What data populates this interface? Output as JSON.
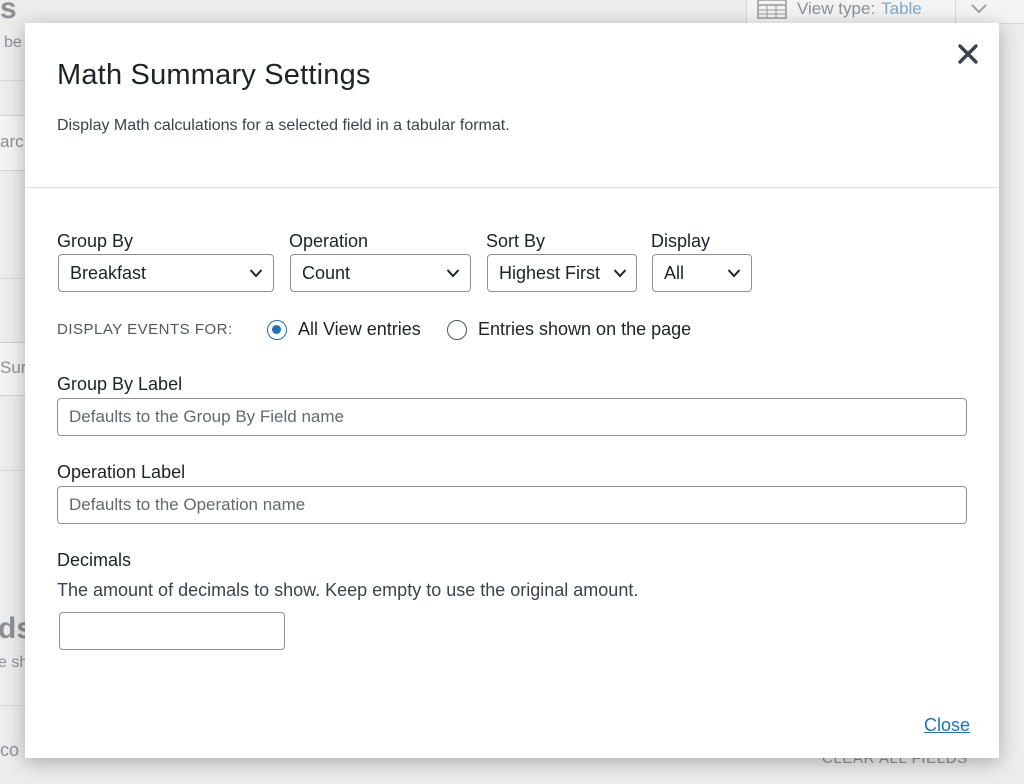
{
  "background": {
    "view_type_label": "View type:",
    "view_type_value": "Table",
    "fragment_s": "s",
    "fragment_be": "be",
    "fragment_arc": "arc",
    "fragment_sur": "Sur",
    "fragment_ds": "ds",
    "fragment_esh": "e sh",
    "fragment_co": "co",
    "clear_all_fields": "CLEAR ALL FIELDS"
  },
  "modal": {
    "title": "Math Summary Settings",
    "description": "Display Math calculations for a selected field in a tabular format.",
    "close_icon": "close-icon",
    "group_by": {
      "label": "Group By",
      "value": "Breakfast"
    },
    "operation": {
      "label": "Operation",
      "value": "Count"
    },
    "sort_by": {
      "label": "Sort By",
      "value": "Highest First"
    },
    "display": {
      "label": "Display",
      "value": "All"
    },
    "display_events": {
      "label": "DISPLAY EVENTS FOR:",
      "options": [
        {
          "label": "All View entries",
          "checked": true
        },
        {
          "label": "Entries shown on the page",
          "checked": false
        }
      ]
    },
    "group_by_label": {
      "label": "Group By Label",
      "placeholder": "Defaults to the Group By Field name",
      "value": ""
    },
    "operation_label": {
      "label": "Operation Label",
      "placeholder": "Defaults to the Operation name",
      "value": ""
    },
    "decimals": {
      "label": "Decimals",
      "help": "The amount of decimals to show. Keep empty to use the original amount.",
      "value": ""
    },
    "close_link": "Close"
  },
  "colors": {
    "accent": "#2271b1",
    "border": "#8c8f94",
    "text": "#1d2327"
  }
}
